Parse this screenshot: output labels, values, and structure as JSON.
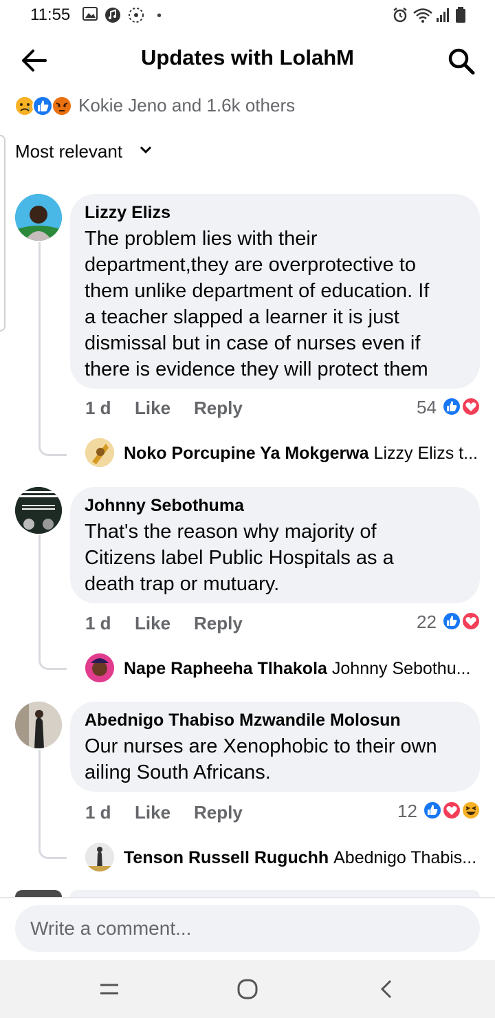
{
  "status": {
    "time": "11:55"
  },
  "header": {
    "title": "Updates with LolahM"
  },
  "reactions_summary": {
    "text": "Kokie Jeno and 1.6k others"
  },
  "sort": {
    "label": "Most relevant"
  },
  "comments": [
    {
      "author": "Lizzy Elizs",
      "text_lines": [
        "The problem lies with their",
        "department,they are overprotective to",
        "them unlike department of education. If",
        "a teacher slapped a learner it is just",
        "dismissal but in case of nurses even if",
        "there is evidence they will protect them"
      ],
      "time": "1 d",
      "like_label": "Like",
      "reply_label": "Reply",
      "reaction_count": "54",
      "reply": {
        "author": "Noko Porcupine Ya Mokgerwa",
        "snippet": "Lizzy Elizs t..."
      }
    },
    {
      "author": "Johnny Sebothuma",
      "text_lines": [
        "That's the reason why majority of",
        "Citizens label Public Hospitals as a",
        "death trap or mutuary."
      ],
      "time": "1 d",
      "like_label": "Like",
      "reply_label": "Reply",
      "reaction_count": "22",
      "reply": {
        "author": "Nape Rapheeha Tlhakola",
        "snippet": "Johnny Sebothu..."
      }
    },
    {
      "author": "Abednigo Thabiso Mzwandile Molosun",
      "text_lines": [
        "Our nurses are Xenophobic to their own",
        "ailing South Africans."
      ],
      "time": "1 d",
      "like_label": "Like",
      "reply_label": "Reply",
      "reaction_count": "12",
      "reply": {
        "author": "Tenson Russell Ruguchh",
        "snippet": "Abednigo Thabis..."
      }
    }
  ],
  "composer": {
    "placeholder": "Write a comment..."
  },
  "colors": {
    "like_blue": "#1877f2",
    "love_red": "#f33e58",
    "haha_yellow": "#f7b125",
    "bubble": "#f0f2f5",
    "meta_gray": "#65676b"
  },
  "icons": [
    "back-arrow-icon",
    "search-icon",
    "sad-reaction-icon",
    "like-reaction-icon",
    "angry-reaction-icon",
    "love-reaction-icon",
    "haha-reaction-icon",
    "chevron-down-icon",
    "recent-apps-icon",
    "home-icon",
    "back-nav-icon"
  ]
}
